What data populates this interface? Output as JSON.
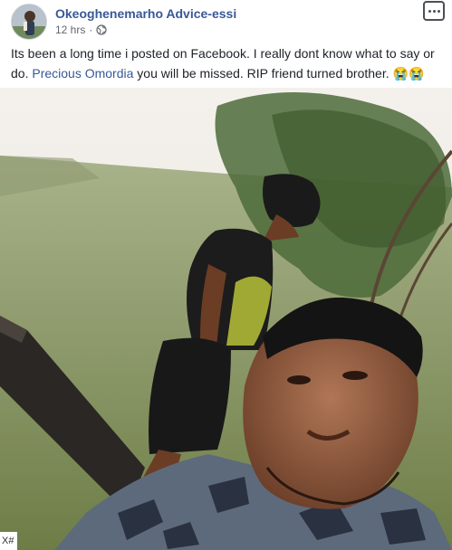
{
  "post": {
    "author": "Okeoghenemarho Advice-essi",
    "time": "12 hrs",
    "privacy_icon": "globe-icon",
    "menu_icon": "more-dots-icon",
    "text_before": "Its been a long time i posted on Facebook. I really dont know what to say or do. ",
    "mention": "Precious Omordia",
    "text_after": " you will be missed. RIP friend turned brother. ",
    "emojis": "😭😭",
    "link_color": "#385898"
  },
  "photo": {
    "description_icon": "selfie-photo"
  },
  "watermark": {
    "text": "X#"
  }
}
